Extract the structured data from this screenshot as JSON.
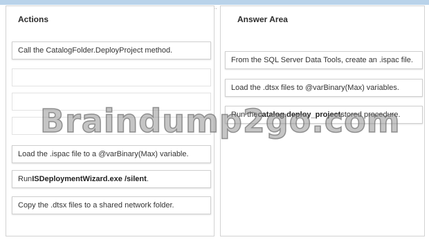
{
  "actions": {
    "header": "Actions",
    "items": [
      {
        "text": "Call the CatalogFolder.DeployProject method."
      },
      {
        "text": ""
      },
      {
        "text": ""
      },
      {
        "text": ""
      },
      {
        "text": "Load the .ispac file to a @varBinary(Max) variable."
      },
      {
        "pre": "Run ",
        "bold": "ISDeploymentWizard.exe /silent",
        "post": "."
      },
      {
        "text": "Copy the .dtsx files to a shared network folder."
      }
    ]
  },
  "answer_area": {
    "header": "Answer Area",
    "items": [
      {
        "text": "From the SQL Server Data Tools, create an .ispac file."
      },
      {
        "text": "Load the .dtsx files to @varBinary(Max) variables."
      },
      {
        "pre": "Run the ",
        "bold": "catalog.deploy_project",
        "post": " stored procedure."
      }
    ]
  },
  "watermark": "Braindump2go.com"
}
